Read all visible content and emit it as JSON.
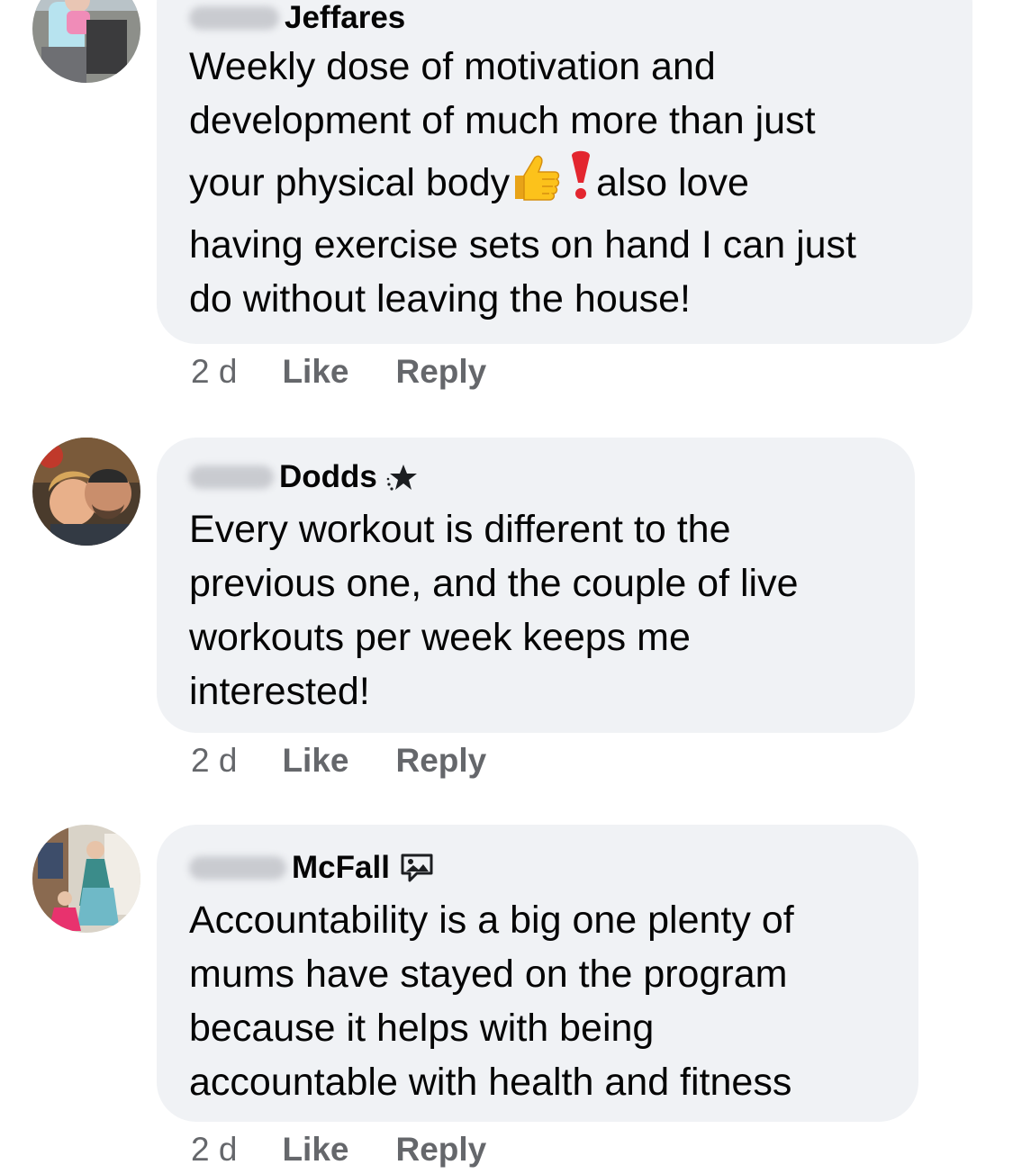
{
  "comments": [
    {
      "author_visible": "Jeffares",
      "author_badge": "none",
      "text_lines": [
        "Weekly dose of motivation and",
        "development of much more than just"
      ],
      "text_line3_before": "your physical body",
      "text_line3_emojis": [
        "thumbs-up-icon",
        "red-exclamation-icon"
      ],
      "text_line3_after": "also love",
      "text_lines_end": [
        "having exercise sets on hand I can just",
        "do without leaving the house!"
      ],
      "timestamp": "2 d",
      "like_label": "Like",
      "reply_label": "Reply"
    },
    {
      "author_visible": "Dodds",
      "author_badge": "rising-star-icon",
      "text_lines": [
        "Every workout is different to the",
        "previous one, and the couple of live",
        "workouts per week keeps me",
        "interested!"
      ],
      "timestamp": "2 d",
      "like_label": "Like",
      "reply_label": "Reply"
    },
    {
      "author_visible": "McFall",
      "author_badge": "visual-storyteller-icon",
      "text_lines": [
        "Accountability is a big one plenty of",
        "mums have stayed on the program",
        "because it helps with being",
        "accountable with health and fitness"
      ],
      "timestamp": "2 d",
      "like_label": "Like",
      "reply_label": "Reply"
    }
  ],
  "colors": {
    "bubble_bg": "#f0f2f5",
    "meta_text": "#65676b",
    "body_text": "#050505"
  }
}
